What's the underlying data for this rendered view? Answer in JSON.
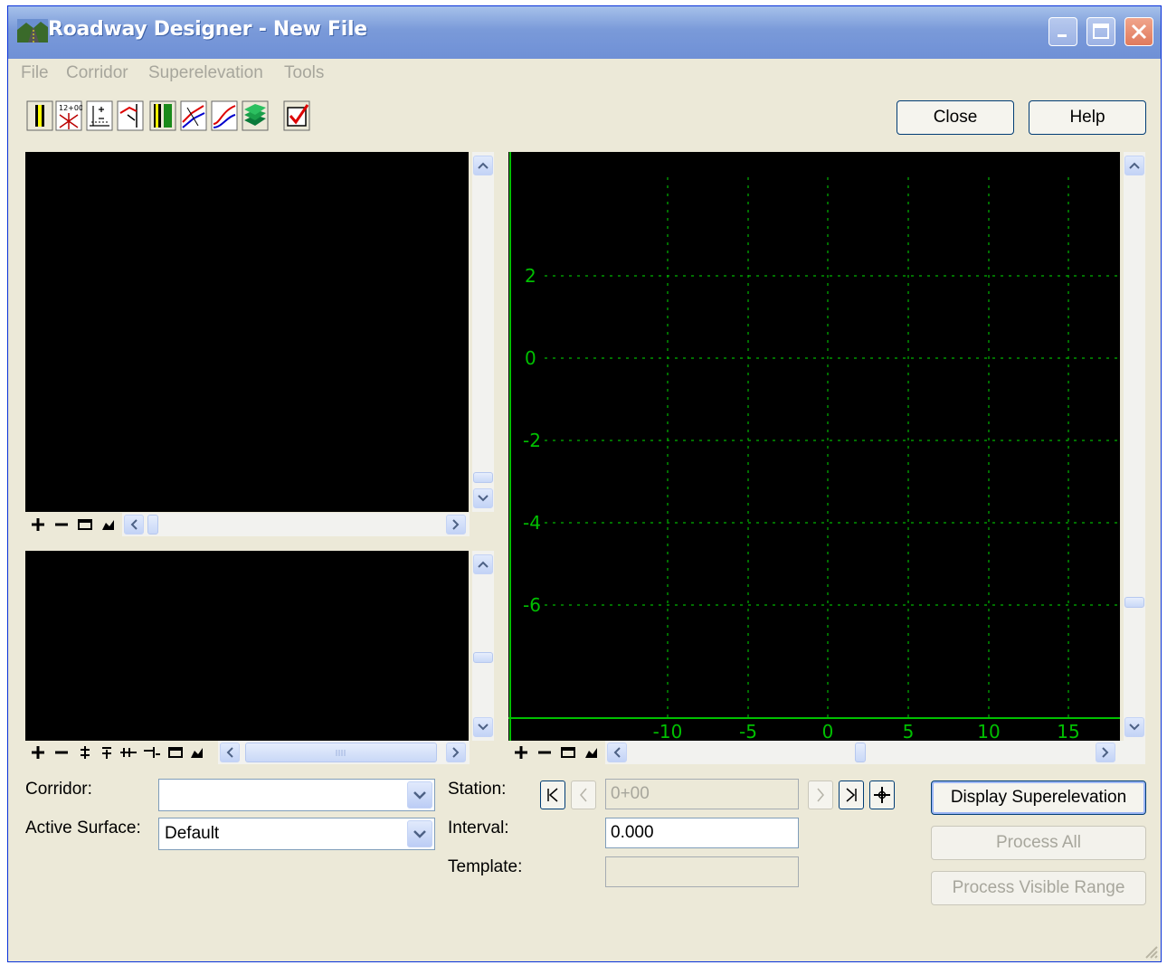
{
  "window": {
    "title": "Roadway Designer - New File"
  },
  "menu": [
    "File",
    "Corridor",
    "Superelevation",
    "Tools"
  ],
  "toolbar": {
    "icons": [
      "template-icon",
      "station-lock-icon",
      "dense-points-icon",
      "alignment-icon",
      "point-controls-icon",
      "parametric-constraints-icon",
      "superelevation-icon",
      "target-aliasing-icon",
      "display-settings-icon"
    ],
    "close_label": "Close",
    "help_label": "Help"
  },
  "profile_view": {
    "y_ticks": [
      "2",
      "0",
      "-2",
      "-4",
      "-6"
    ],
    "x_ticks": [
      "-10",
      "-5",
      "0",
      "5",
      "10",
      "15"
    ],
    "grid_color": "#00b400",
    "axis_color": "#00c000"
  },
  "form": {
    "corridor_label": "Corridor:",
    "corridor_value": "",
    "active_surface_label": "Active Surface:",
    "active_surface_value": "Default",
    "station_label": "Station:",
    "station_value": "0+00",
    "interval_label": "Interval:",
    "interval_value": "0.000",
    "template_label": "Template:",
    "template_value": ""
  },
  "actions": {
    "display_superelevation": "Display  Superelevation",
    "process_all": "Process All",
    "process_visible_range": "Process Visible Range"
  }
}
